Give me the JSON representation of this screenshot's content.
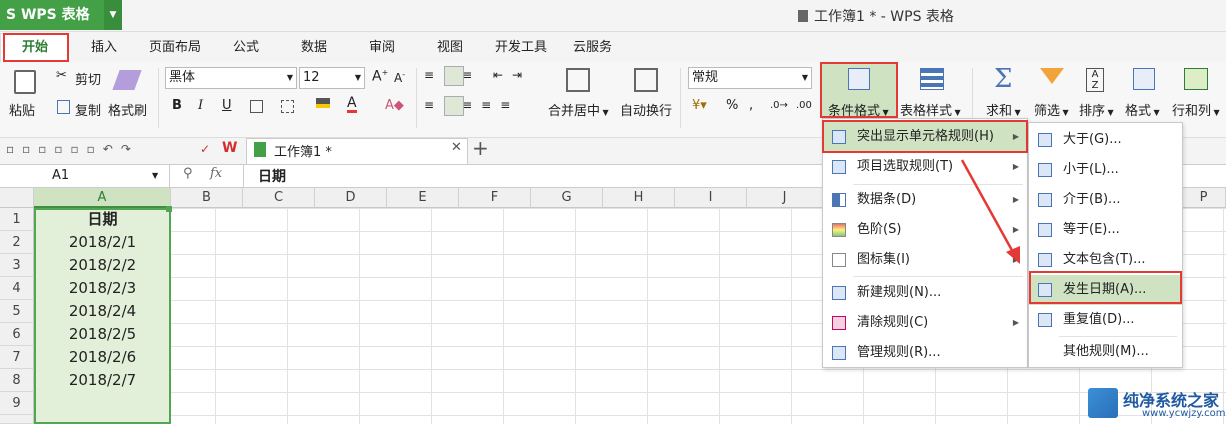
{
  "app": {
    "name": "WPS 表格",
    "window_title": "工作簿1 * - WPS 表格"
  },
  "menu_tabs": [
    "开始",
    "插入",
    "页面布局",
    "公式",
    "数据",
    "审阅",
    "视图",
    "开发工具",
    "云服务"
  ],
  "ribbon": {
    "cut": "剪切",
    "paste": "粘贴",
    "copy": "复制",
    "format_painter": "格式刷",
    "font_name": "黑体",
    "font_size": "12",
    "merge_center": "合并居中",
    "wrap_text": "自动换行",
    "number_format": "常规",
    "conditional_format": "条件格式",
    "table_style": "表格样式",
    "sum": "求和",
    "filter": "筛选",
    "sort": "排序",
    "format": "格式",
    "rows_cols": "行和列"
  },
  "doc_tab": "工作簿1 *",
  "formula_bar": {
    "name_box": "A1",
    "fx": "fx",
    "value": "日期"
  },
  "columns": [
    "A",
    "B",
    "C",
    "D",
    "E",
    "F",
    "G",
    "H",
    "I",
    "J",
    "P"
  ],
  "rows": [
    "1",
    "2",
    "3",
    "4",
    "5",
    "6",
    "7",
    "8",
    "9"
  ],
  "cells_A": [
    "日期",
    "2018/2/1",
    "2018/2/2",
    "2018/2/3",
    "2018/2/4",
    "2018/2/5",
    "2018/2/6",
    "2018/2/7",
    ""
  ],
  "cond_menu": [
    "突出显示单元格规则(H)",
    "项目选取规则(T)",
    "数据条(D)",
    "色阶(S)",
    "图标集(I)",
    "新建规则(N)...",
    "清除规则(C)",
    "管理规则(R)..."
  ],
  "highlight_submenu": [
    "大于(G)...",
    "小于(L)...",
    "介于(B)...",
    "等于(E)...",
    "文本包含(T)...",
    "发生日期(A)...",
    "重复值(D)...",
    "其他规则(M)..."
  ],
  "watermark": {
    "title": "纯净系统之家",
    "url": "www.ycwjzy.com"
  },
  "colors": {
    "accent_green": "#43a047",
    "selection_fill": "#e2f0d9",
    "highlight_red": "#e53935"
  }
}
